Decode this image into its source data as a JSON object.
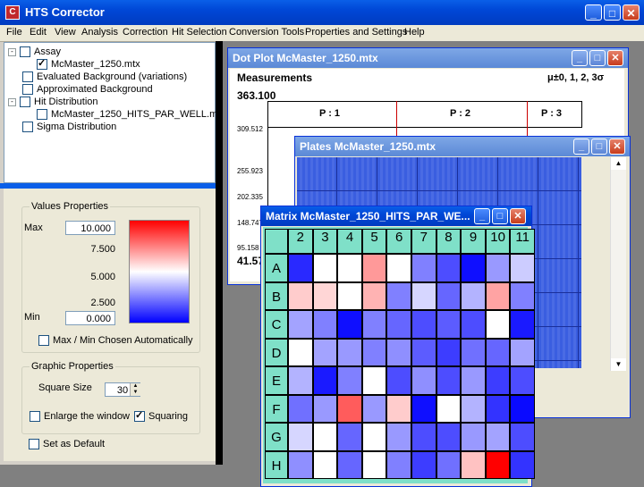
{
  "app": {
    "title": "HTS Corrector",
    "icon_letter": "C",
    "title_buttons": [
      "_",
      "□",
      "✕"
    ]
  },
  "menu": [
    "File",
    "Edit",
    "View",
    "Analysis",
    "Correction",
    "Hit Selection",
    "Conversion Tools",
    "Properties and Settings",
    "Help"
  ],
  "tree": {
    "items": [
      {
        "label": "Assay",
        "checked": false,
        "level": 0,
        "expander": "-"
      },
      {
        "label": "McMaster_1250.mtx",
        "checked": true,
        "level": 1
      },
      {
        "label": "Evaluated Background (variations)",
        "checked": false,
        "level": 0
      },
      {
        "label": "Approximated Background",
        "checked": false,
        "level": 0
      },
      {
        "label": "Hit Distribution",
        "checked": false,
        "level": 0,
        "expander": "-"
      },
      {
        "label": "McMaster_1250_HITS_PAR_WELL.mtx",
        "checked": false,
        "level": 1
      },
      {
        "label": "Sigma Distribution",
        "checked": false,
        "level": 0
      }
    ]
  },
  "values_properties": {
    "title": "Values Properties",
    "max_label": "Max",
    "max_value": "10.000",
    "min_label": "Min",
    "min_value": "0.000",
    "scale_ticks": [
      "7.500",
      "5.000",
      "2.500"
    ],
    "auto_label": "Max / Min Chosen Automatically"
  },
  "graphic_properties": {
    "title": "Graphic Properties",
    "square_size_label": "Square Size",
    "square_size_value": "30",
    "enlarge_label": "Enlarge the window",
    "squaring_label": "Squaring"
  },
  "set_default_label": "Set as Default",
  "dotplot": {
    "title": "Dot Plot McMaster_1250.mtx",
    "measurements_label": "Measurements",
    "sigma_label": "μ±0, 1, 2, 3σ",
    "y_max": "363.100",
    "y_ticks": [
      "309.512",
      "255.923",
      "202.335",
      "148.747",
      "95.158"
    ],
    "y_bottom": "41.57",
    "plates": [
      "P : 1",
      "P : 2",
      "P : 3"
    ]
  },
  "plates_window": {
    "title": "Plates McMaster_1250.mtx"
  },
  "matrix": {
    "title": "Matrix McMaster_1250_HITS_PAR_WE...",
    "columns": [
      "2",
      "3",
      "4",
      "5",
      "6",
      "7",
      "8",
      "9",
      "10",
      "11"
    ],
    "rows": [
      "A",
      "B",
      "C",
      "D",
      "E",
      "F",
      "G",
      "H"
    ],
    "values": [
      [
        0.8,
        5,
        5,
        7,
        5,
        2.5,
        1.5,
        0.3,
        3,
        4
      ],
      [
        6,
        5.8,
        5,
        6.5,
        2.5,
        4.2,
        2,
        3.5,
        6.8,
        2.5
      ],
      [
        3.2,
        2.5,
        0.3,
        2.5,
        2,
        1.5,
        1.8,
        1.5,
        5,
        0.5
      ],
      [
        5,
        3.2,
        3,
        2.5,
        2.8,
        1.8,
        1.2,
        2.2,
        2,
        3.2
      ],
      [
        3.5,
        0.5,
        2.5,
        5,
        1.5,
        2.8,
        1.5,
        3,
        1.2,
        1.5
      ],
      [
        2.2,
        3,
        8.2,
        3,
        6,
        0.3,
        5,
        3.5,
        1,
        0.2
      ],
      [
        4.2,
        5,
        2,
        5,
        3,
        1.5,
        1.5,
        3,
        3.2,
        1.5
      ],
      [
        2.8,
        5,
        2,
        5,
        2.5,
        1.2,
        2.2,
        6.2,
        10,
        1
      ]
    ]
  },
  "colors": {
    "title_blue": "#0047d6",
    "header_teal": "#7fe0c8",
    "low": "#0000ff",
    "mid": "#ffffff",
    "high": "#ff0000"
  }
}
